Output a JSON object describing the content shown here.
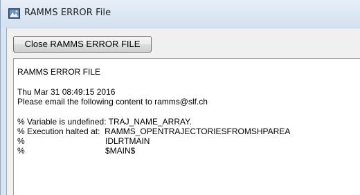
{
  "window": {
    "title": "RAMMS ERROR File",
    "title_icon": "ramms-app-icon"
  },
  "toolbar": {
    "close_label": "Close RAMMS ERROR FILE"
  },
  "content": {
    "heading": "RAMMS ERROR FILE",
    "timestamp": "Thu Mar 31 08:49:15 2016",
    "email_note": "Please email the following content to ramms@slf.ch",
    "error_lines": [
      {
        "prefix": "%",
        "text": " Variable is undefined: TRAJ_NAME_ARRAY."
      },
      {
        "prefix": "%",
        "text": " Execution halted at:  RAMMS_OPENTRAJECTORIESFROMSHPAREA"
      },
      {
        "prefix": "%",
        "text": "IDLRTMAIN"
      },
      {
        "prefix": "%",
        "text": "$MAIN$"
      }
    ]
  },
  "colors": {
    "titlebar": "#dbe6f3",
    "client": "#f0f0f0",
    "textarea": "#ffffff"
  }
}
